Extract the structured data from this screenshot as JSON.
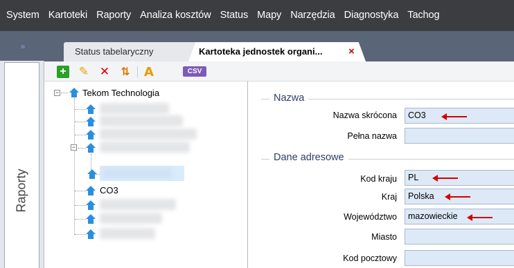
{
  "menu": {
    "items": [
      "System",
      "Kartoteki",
      "Raporty",
      "Analiza kosztów",
      "Status",
      "Mapy",
      "Narzędzia",
      "Diagnostyka",
      "Tachog"
    ]
  },
  "sidebar": {
    "collapse_glyph": "»",
    "raporty_label": "Raporty"
  },
  "tabs": [
    {
      "label": "Status tabelaryczny",
      "active": false
    },
    {
      "label": "Kartoteka jednostek organi...",
      "active": true,
      "close_glyph": "×"
    }
  ],
  "toolbar": {
    "add_glyph": "+",
    "edit_glyph": "✎",
    "delete_glyph": "✕",
    "sort_glyph": "⇅",
    "font_glyph": "A",
    "csv_label": "CSV"
  },
  "tree": {
    "expander_collapse": "−",
    "root": {
      "label": "Tekom Technologia"
    },
    "nodes": [
      {
        "label": ""
      },
      {
        "label": ""
      },
      {
        "label": ""
      },
      {
        "label": ""
      },
      {
        "label": ""
      },
      {
        "label": "CO3"
      },
      {
        "label": ""
      },
      {
        "label": ""
      },
      {
        "label": ""
      }
    ]
  },
  "form": {
    "groups": {
      "nazwa": "Nazwa",
      "dane_adresowe": "Dane adresowe"
    },
    "fields": {
      "nazwa_skrocona": {
        "label": "Nazwa skrócona",
        "value": "CO3"
      },
      "pelna_nazwa": {
        "label": "Pełna nazwa",
        "value": ""
      },
      "kod_kraju": {
        "label": "Kod kraju",
        "value": "PL"
      },
      "kraj": {
        "label": "Kraj",
        "value": "Polska"
      },
      "wojewodztwo": {
        "label": "Województwo",
        "value": "mazowieckie"
      },
      "miasto": {
        "label": "Miasto",
        "value": ""
      },
      "kod_pocztowy": {
        "label": "Kod pocztowy",
        "value": ""
      }
    }
  },
  "colors": {
    "menu_bg": "#3b3d40",
    "accent_blue": "#2a8fe0",
    "annotation_arrow": "#d40000",
    "input_bg": "#dde9f7"
  }
}
